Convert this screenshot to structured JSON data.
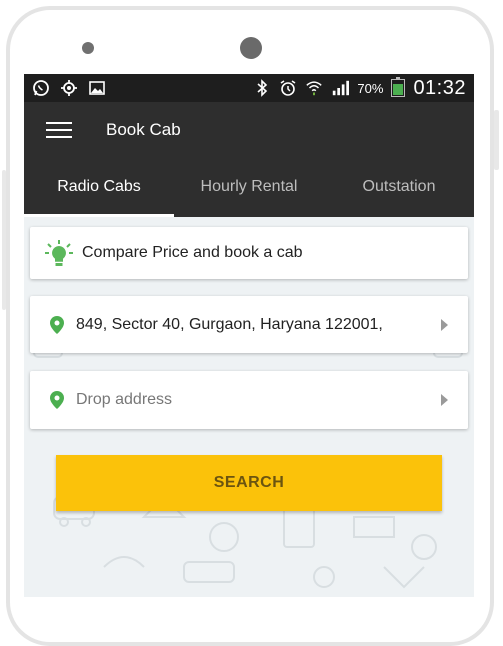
{
  "status_bar": {
    "battery": "70%",
    "time": "01:32"
  },
  "toolbar": {
    "title": "Book Cab"
  },
  "tabs": [
    {
      "label": "Radio Cabs",
      "active": true
    },
    {
      "label": "Hourly Rental",
      "active": false
    },
    {
      "label": "Outstation",
      "active": false
    }
  ],
  "compare_card": {
    "label": "Compare Price and book a cab"
  },
  "pickup": {
    "value": "849, Sector 40, Gurgaon, Haryana 122001,"
  },
  "drop": {
    "placeholder": "Drop address"
  },
  "search_button": {
    "label": "SEARCH"
  },
  "colors": {
    "accent": "#fbc20a",
    "location_pin": "#4caf50",
    "toolbar": "#2e2e2e",
    "status_bar": "#1e1e1e"
  }
}
